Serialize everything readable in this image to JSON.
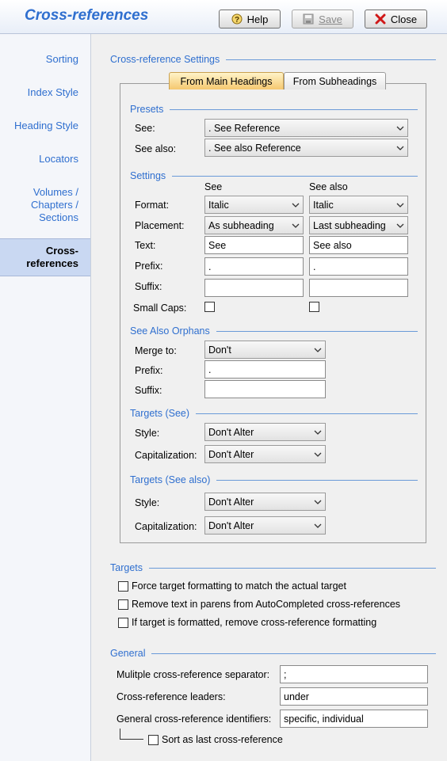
{
  "window": {
    "title": "Cross-references"
  },
  "header_buttons": {
    "help": "Help",
    "save": "Save",
    "close": "Close"
  },
  "sidebar": {
    "items": [
      {
        "label": "Sorting"
      },
      {
        "label": "Index Style"
      },
      {
        "label": "Heading Style"
      },
      {
        "label": "Locators"
      },
      {
        "label": "Volumes / Chapters / Sections",
        "lines": [
          "Volumes /",
          "Chapters /",
          "Sections"
        ]
      },
      {
        "label": "Cross-references",
        "lines": [
          "Cross-",
          "references"
        ],
        "active": true
      }
    ]
  },
  "settings": {
    "heading": "Cross-reference Settings",
    "tabs": [
      "From Main Headings",
      "From Subheadings"
    ],
    "active_tab": 0,
    "presets": {
      "heading": "Presets",
      "see_label": "See:",
      "see_value": ". See Reference",
      "see_also_label": "See also:",
      "see_also_value": ". See also Reference"
    },
    "settings_group": {
      "heading": "Settings",
      "col_see": "See",
      "col_see_also": "See also",
      "format_label": "Format:",
      "format_see": "Italic",
      "format_see_also": "Italic",
      "placement_label": "Placement:",
      "placement_see": "As subheading",
      "placement_see_also": "Last subheading",
      "text_label": "Text:",
      "text_see": "See",
      "text_see_also": "See also",
      "prefix_label": "Prefix:",
      "prefix_see": ".",
      "prefix_see_also": ".",
      "suffix_label": "Suffix:",
      "suffix_see": "",
      "suffix_see_also": "",
      "small_caps_label": "Small Caps:"
    },
    "orphans": {
      "heading": "See Also Orphans",
      "merge_label": "Merge to:",
      "merge_value": "Don't",
      "prefix_label": "Prefix:",
      "prefix_value": ".",
      "suffix_label": "Suffix:",
      "suffix_value": ""
    },
    "targets_see": {
      "heading": "Targets (See)",
      "style_label": "Style:",
      "style_value": "Don't Alter",
      "cap_label": "Capitalization:",
      "cap_value": "Don't Alter"
    },
    "targets_see_also": {
      "heading": "Targets (See also)",
      "style_label": "Style:",
      "style_value": "Don't Alter",
      "cap_label": "Capitalization:",
      "cap_value": "Don't Alter"
    }
  },
  "targets": {
    "heading": "Targets",
    "options": [
      "Force target formatting to match the actual target",
      "Remove text in parens from AutoCompleted cross-references",
      "If target is formatted, remove cross-reference formatting"
    ]
  },
  "general": {
    "heading": "General",
    "separator_label": "Mulitple cross-reference separator:",
    "separator_value": ";",
    "leaders_label": "Cross-reference leaders:",
    "leaders_value": "under",
    "identifiers_label": "General cross-reference identifiers:",
    "identifiers_value": "specific, individual",
    "sort_last_label": "Sort as last cross-reference"
  }
}
